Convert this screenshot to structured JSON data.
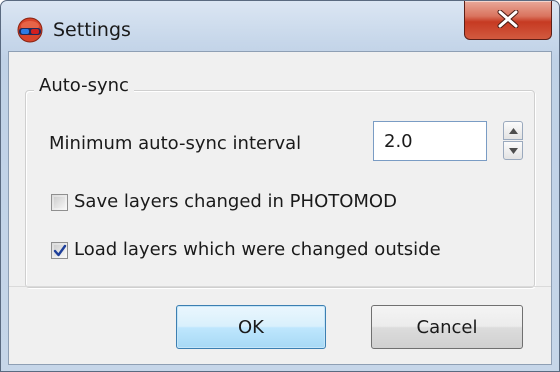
{
  "window": {
    "title": "Settings",
    "icons": {
      "app": "red-glasses-icon",
      "close": "close-icon"
    },
    "colors": {
      "close_button": "#c63a22",
      "ok_border": "#3c7fb1"
    }
  },
  "group": {
    "legend": "Auto-sync",
    "interval": {
      "label": "Minimum auto-sync interval",
      "value": "2.0"
    },
    "save_layers": {
      "label": "Save layers changed in PHOTOMOD",
      "checked": false
    },
    "load_layers": {
      "label": "Load layers which were changed outside",
      "checked": true
    }
  },
  "buttons": {
    "ok": "OK",
    "cancel": "Cancel"
  }
}
